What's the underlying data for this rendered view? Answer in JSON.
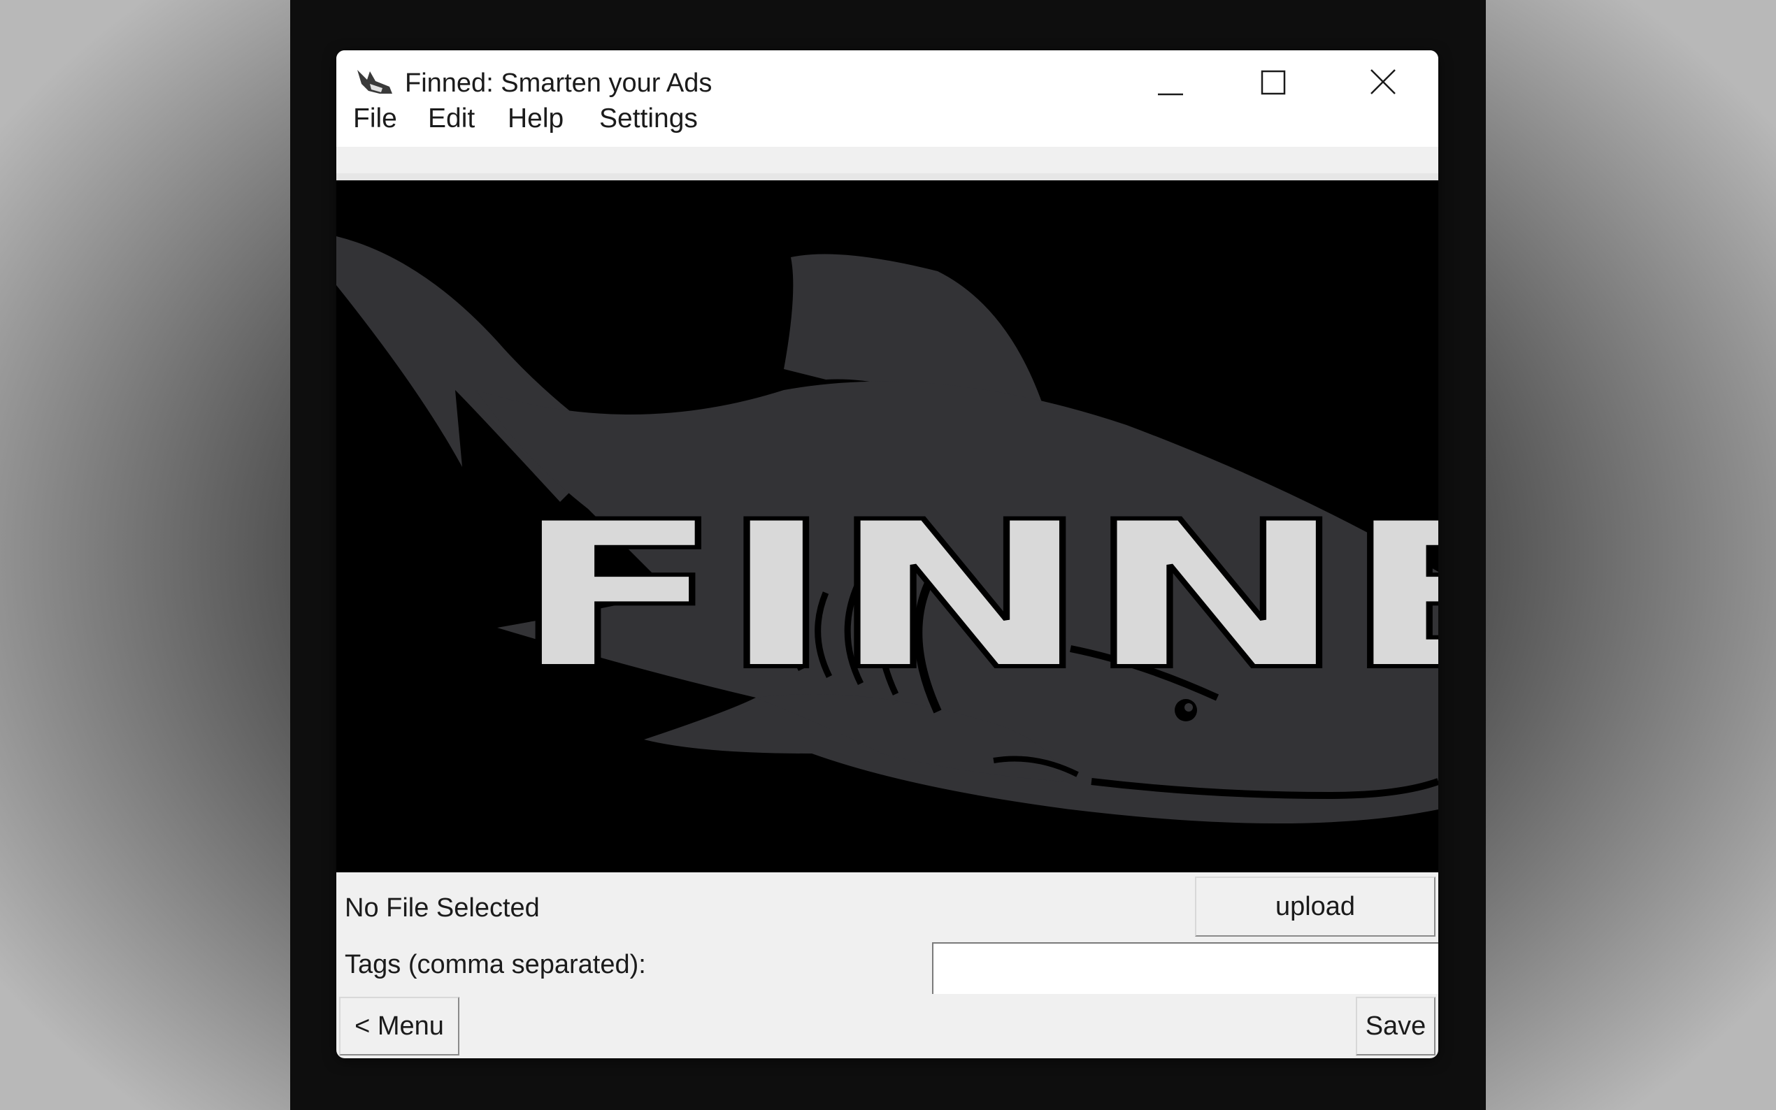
{
  "window": {
    "title": "Finned: Smarten your Ads",
    "app_icon": "shark-fin-icon",
    "controls": {
      "minimize_icon": "minimize-icon",
      "maximize_icon": "maximize-icon",
      "close_icon": "close-icon"
    }
  },
  "menubar": {
    "items": [
      {
        "label": "File"
      },
      {
        "label": "Edit"
      },
      {
        "label": "Help"
      },
      {
        "label": "Settings"
      }
    ]
  },
  "banner": {
    "logo_text": "FINNED",
    "colors": {
      "background": "#000000",
      "shark": "#333336",
      "text": "#d9d9d9"
    }
  },
  "upload": {
    "status": "No File Selected",
    "button_label": "upload"
  },
  "tags": {
    "label": "Tags (comma separated):",
    "value": ""
  },
  "footer": {
    "menu_button_label": "< Menu",
    "save_button_label": "Save"
  }
}
